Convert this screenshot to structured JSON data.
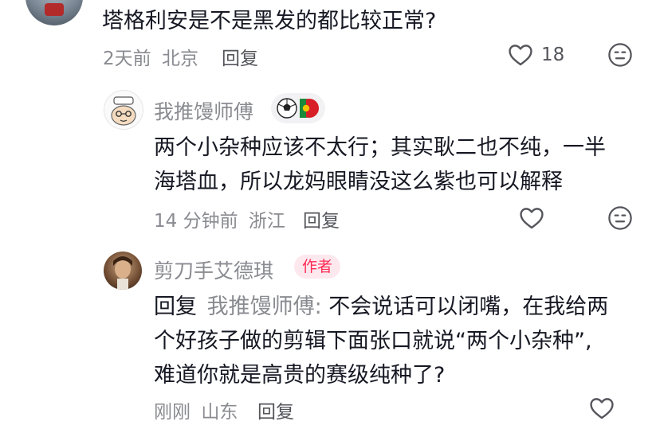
{
  "comment1": {
    "text": "塔格利安是不是黑发的都比较正常?",
    "time": "2天前",
    "location": "北京",
    "reply_label": "回复",
    "like_count": "18",
    "like_icon": "heart-outline",
    "dislike_icon": "meh-face"
  },
  "comment2": {
    "username": "我推馒师傅",
    "badge_icon": "football-portugal-flag",
    "text_line1": "两个小杂种应该不太行；其实耿二也不纯，一半",
    "text_line2": "海塔血，所以龙妈眼睛没这么紫也可以解释",
    "time": "14 分钟前",
    "location": "浙江",
    "reply_label": "回复",
    "like_icon": "heart-outline",
    "dislike_icon": "meh-face"
  },
  "comment3": {
    "username": "剪刀手艾德琪",
    "author_badge": "作者",
    "reply_prefix": "回复",
    "mention": "我推馒师傅:",
    "text_line1_rest": "不会说话可以闭嘴，在我给两",
    "text_line2": "个好孩子做的剪辑下面张口就说“两个小杂种”,",
    "text_line3": "难道你就是高贵的赛级纯种了?",
    "time": "刚刚",
    "location": "山东",
    "reply_label": "回复",
    "like_icon": "heart-outline"
  },
  "colors": {
    "accent": "#fe2c55",
    "meta_gray": "#8a8b91",
    "text": "#161823"
  }
}
